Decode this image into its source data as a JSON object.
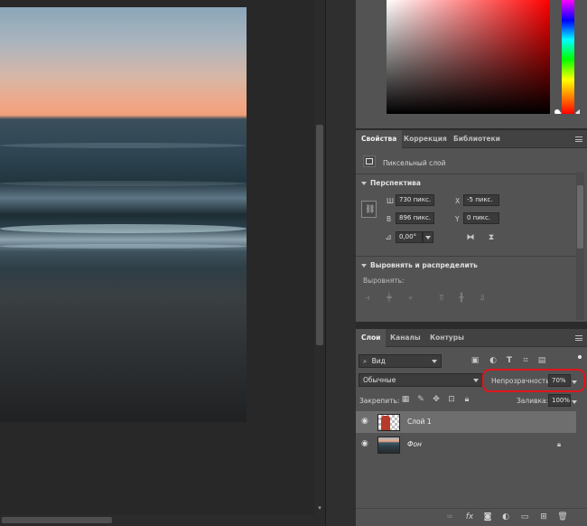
{
  "properties_panel": {
    "tabs": [
      {
        "label": "Свойства",
        "active": true
      },
      {
        "label": "Коррекция",
        "active": false
      },
      {
        "label": "Библиотеки",
        "active": false
      }
    ],
    "layer_type": "Пиксельный слой",
    "perspective": {
      "title": "Перспектива",
      "w_label": "Ш",
      "w_value": "730 пикс.",
      "h_label": "В",
      "h_value": "896 пикс.",
      "x_label": "X",
      "x_value": "-5 пикс.",
      "y_label": "Y",
      "y_value": "0 пикс.",
      "angle_value": "0,00°"
    },
    "align": {
      "title": "Выровнять и распределить",
      "subtitle": "Выровнять:"
    }
  },
  "layers_panel": {
    "tabs": [
      {
        "label": "Слои",
        "active": true
      },
      {
        "label": "Каналы",
        "active": false
      },
      {
        "label": "Контуры",
        "active": false
      }
    ],
    "filter_kind": "Вид",
    "blend_mode": "Обычные",
    "opacity_label": "Непрозрачность:",
    "opacity_value": "70%",
    "lock_label": "Закрепить:",
    "fill_label": "Заливка:",
    "fill_value": "100%",
    "layers": [
      {
        "name": "Слой 1",
        "selected": true,
        "locked": false
      },
      {
        "name": "Фон",
        "selected": false,
        "locked": true
      }
    ]
  },
  "colors": {
    "highlight": "#e0151b",
    "panel_bg": "#535353",
    "selected_layer": "#6e6e6e"
  }
}
